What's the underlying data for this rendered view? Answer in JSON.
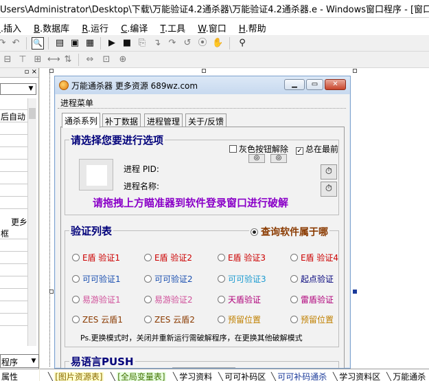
{
  "titlebar": {
    "text": "Users\\Administrator\\Desktop\\下载\\万能验证4.2通杀器\\万能验证4.2通杀器.e - Windows窗口程序 - [窗口: _启动窗"
  },
  "menubar": {
    "items": [
      {
        "key": "I",
        "label": ".插入"
      },
      {
        "key": "B",
        "label": ".数据库"
      },
      {
        "key": "R",
        "label": ".运行"
      },
      {
        "key": "C",
        "label": ".编译"
      },
      {
        "key": "T",
        "label": ".工具"
      },
      {
        "key": "W",
        "label": ".窗口"
      },
      {
        "key": "H",
        "label": ".帮助"
      }
    ]
  },
  "leftpanel": {
    "header": "▫ ×",
    "text1": "后自动",
    "text2": "更乡",
    "text3": "框",
    "bottom_value": "程序",
    "prop_tab": "属性"
  },
  "window": {
    "title": "万能通杀器   更多资源 689wz.com",
    "menu": "进程菜单",
    "tabs": [
      "通杀系列",
      "补丁数据",
      "进程管理",
      "关于/反馈"
    ],
    "select_group": {
      "title": "请选择您要进行选项",
      "chk_gray": "灰色按钮解除",
      "chk_top": "总在最前",
      "pid_label": "进程 PID:",
      "name_label": "进程名称:",
      "hint": "请拖拽上方瞄准器到软件登录窗口进行破解"
    },
    "verify_group": {
      "title": "验证列表",
      "query": "查询软件属于哪",
      "note": "Ps.更换模式时，关闭并重新运行需破解程序，在更换其他破解模式"
    },
    "radios": [
      {
        "label": "E盾 验证1",
        "color": "#cc0000"
      },
      {
        "label": "E盾 验证2",
        "color": "#cc0000"
      },
      {
        "label": "E盾 验证3",
        "color": "#cc0000"
      },
      {
        "label": "E盾 验证4",
        "color": "#cc0000"
      },
      {
        "label": "可可验证1",
        "color": "#1a4fb0"
      },
      {
        "label": "可可验证2",
        "color": "#1a4fb0"
      },
      {
        "label": "可可验证3",
        "color": "#1a9ad0"
      },
      {
        "label": "起点验证",
        "color": "#00007a"
      },
      {
        "label": "易游验证1",
        "color": "#d0509a"
      },
      {
        "label": "易游验证2",
        "color": "#d0509a"
      },
      {
        "label": "天盾验证",
        "color": "#b0007a"
      },
      {
        "label": "雷盾验证",
        "color": "#b0007a"
      },
      {
        "label": "ZES 云盾1",
        "color": "#8a3a00"
      },
      {
        "label": "ZES 云盾2",
        "color": "#8a3a00"
      },
      {
        "label": "预留位置",
        "color": "#c08000"
      },
      {
        "label": "预留位置",
        "color": "#c08000"
      }
    ],
    "push_title": "易语言PUSH"
  },
  "bottomtabs": [
    "[图片资源表]",
    "[全局变量表]",
    "学习资料",
    "可可补码区",
    "可可补码通杀",
    "学习资料区",
    "万能通杀"
  ]
}
